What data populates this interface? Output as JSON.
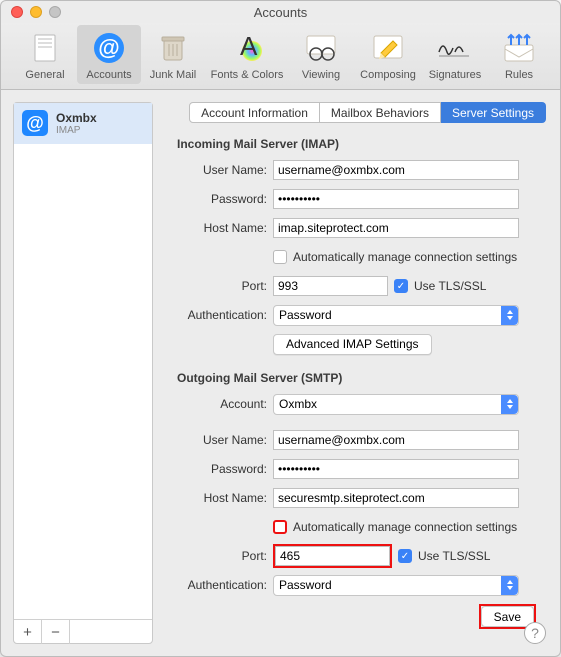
{
  "window": {
    "title": "Accounts"
  },
  "toolbar": {
    "items": [
      {
        "label": "General"
      },
      {
        "label": "Accounts"
      },
      {
        "label": "Junk Mail"
      },
      {
        "label": "Fonts & Colors"
      },
      {
        "label": "Viewing"
      },
      {
        "label": "Composing"
      },
      {
        "label": "Signatures"
      },
      {
        "label": "Rules"
      }
    ]
  },
  "sidebar": {
    "account_name": "Oxmbx",
    "account_type": "IMAP",
    "add": "+",
    "remove": "−"
  },
  "tabs": {
    "info": "Account Information",
    "behaviors": "Mailbox Behaviors",
    "server": "Server Settings"
  },
  "incoming": {
    "title": "Incoming Mail Server (IMAP)",
    "username_label": "User Name:",
    "username": "username@oxmbx.com",
    "password_label": "Password:",
    "password": "••••••••••",
    "host_label": "Host Name:",
    "host": "imap.siteprotect.com",
    "auto_label": "Automatically manage connection settings",
    "port_label": "Port:",
    "port": "993",
    "tls_label": "Use TLS/SSL",
    "auth_label": "Authentication:",
    "auth_value": "Password",
    "advanced_btn": "Advanced IMAP Settings"
  },
  "outgoing": {
    "title": "Outgoing Mail Server (SMTP)",
    "account_label": "Account:",
    "account_value": "Oxmbx",
    "username_label": "User Name:",
    "username": "username@oxmbx.com",
    "password_label": "Password:",
    "password": "••••••••••",
    "host_label": "Host Name:",
    "host": "securesmtp.siteprotect.com",
    "auto_label": "Automatically manage connection settings",
    "port_label": "Port:",
    "port": "465",
    "tls_label": "Use TLS/SSL",
    "auth_label": "Authentication:",
    "auth_value": "Password",
    "save_btn": "Save"
  },
  "help": "?"
}
